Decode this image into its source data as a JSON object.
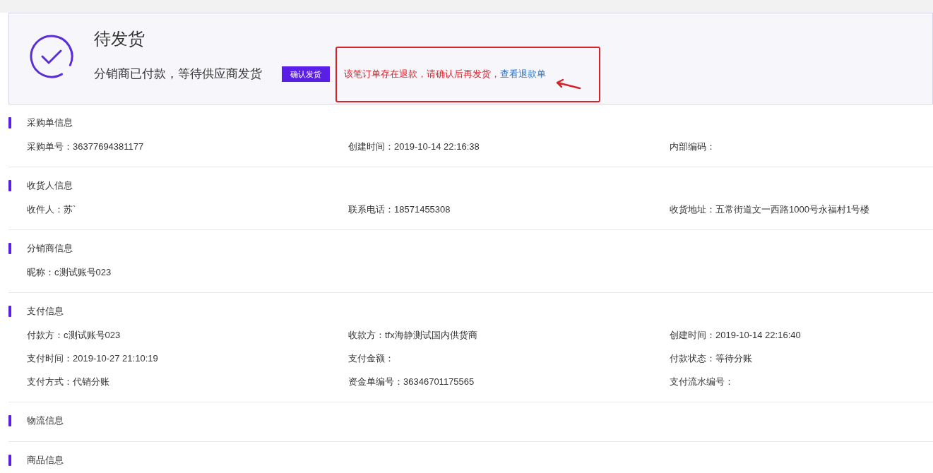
{
  "status": {
    "title": "待发货",
    "subtitle": "分销商已付款，等待供应商发货",
    "button": "确认发货",
    "warning": "该笔订单存在退款，请确认后再发货，",
    "link": "查看退款单"
  },
  "sections": [
    {
      "title": "采购单信息",
      "rows": [
        [
          "采购单号：36377694381177",
          "创建时间：2019-10-14 22:16:38",
          "内部编码："
        ]
      ]
    },
    {
      "title": "收货人信息",
      "rows": [
        [
          "收件人：苏`",
          "联系电话：18571455308",
          "收货地址：五常街道文一西路1000号永福村1号楼"
        ]
      ]
    },
    {
      "title": "分销商信息",
      "rows": [
        [
          "昵称：c测试账号023"
        ]
      ]
    },
    {
      "title": "支付信息",
      "rows": [
        [
          "付款方：c测试账号023",
          "收款方：tfx海静测试国内供货商",
          "创建时间：2019-10-14 22:16:40"
        ],
        [
          "支付时间：2019-10-27 21:10:19",
          "支付金额：",
          "付款状态：等待分账"
        ],
        [
          "支付方式：代销分账",
          "资金单编号：36346701175565",
          "支付流水编号："
        ]
      ]
    },
    {
      "title": "物流信息"
    },
    {
      "title": "商品信息"
    }
  ]
}
